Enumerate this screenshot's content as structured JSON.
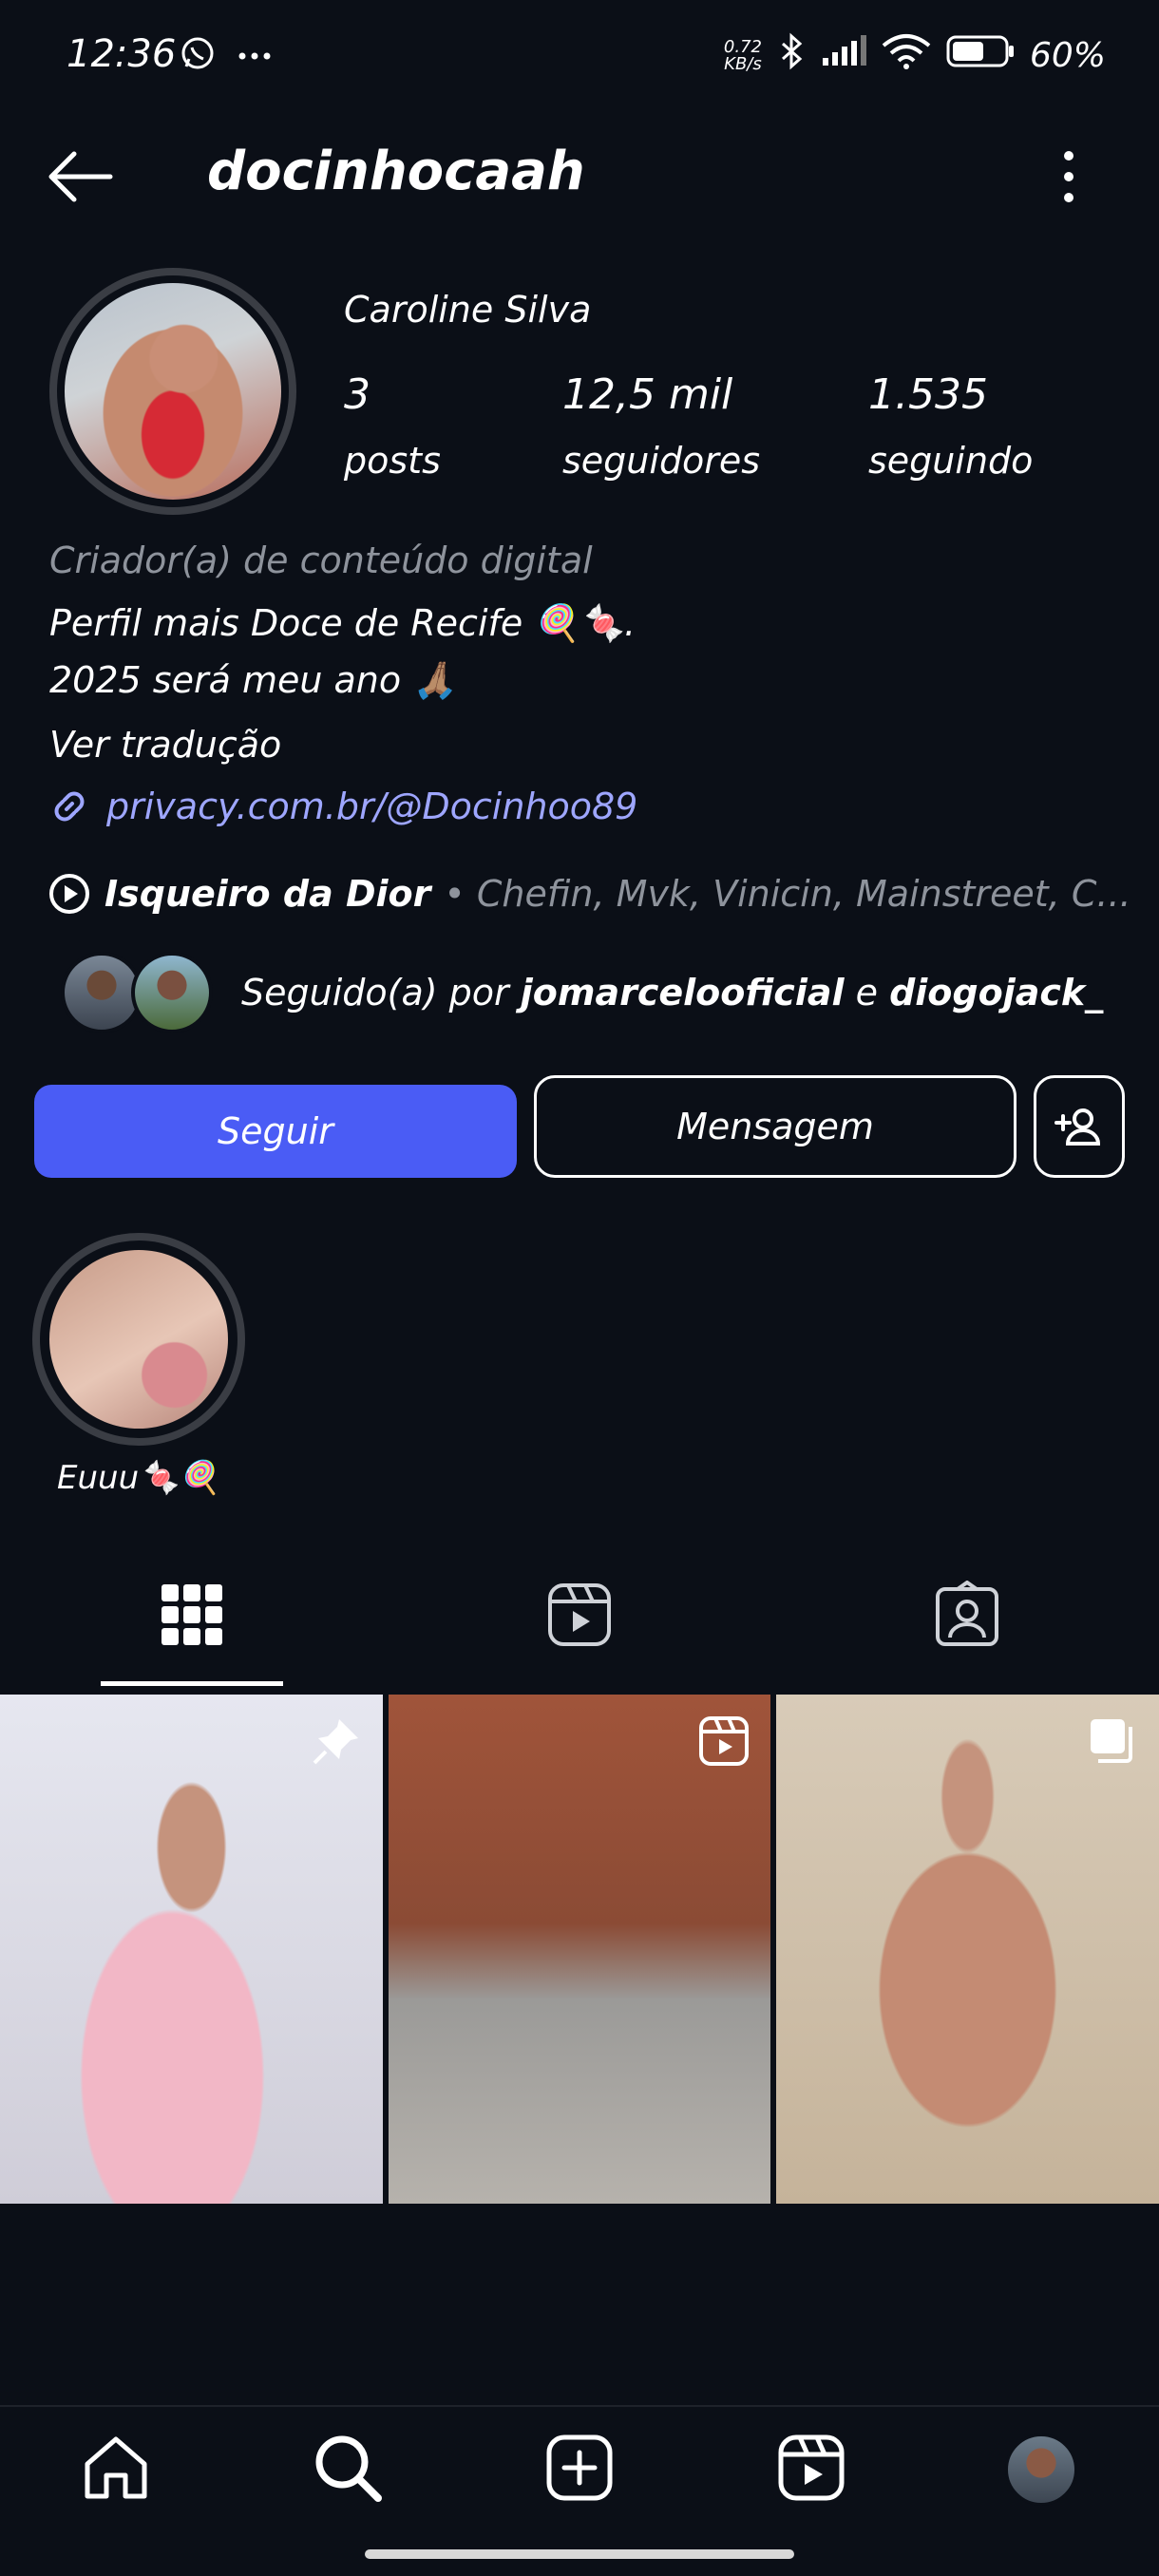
{
  "status_bar": {
    "time": "12:36",
    "net_speed_value": "0.72",
    "net_speed_unit": "KB/s",
    "battery": "60%",
    "icons": [
      "whatsapp-icon",
      "more-dots-icon",
      "bluetooth-icon",
      "signal-icon",
      "wifi-icon",
      "battery-icon"
    ]
  },
  "header": {
    "username": "docinhocaah"
  },
  "profile": {
    "full_name": "Caroline Silva",
    "posts_count": "3",
    "posts_label": "posts",
    "followers_count": "12,5 mil",
    "followers_label": "seguidores",
    "following_count": "1.535",
    "following_label": "seguindo",
    "category": "Criador(a) de conteúdo digital",
    "bio_line1": "Perfil mais Doce de Recife 🍭🍬.",
    "bio_line2": "2025 será meu ano 🙏🏽",
    "translate": "Ver tradução",
    "link": "privacy.com.br/@Docinhoo89",
    "music_title": "Isqueiro da Dior",
    "music_artists": "• Chefin, Mvk, Vinicin, Mainstreet, C...",
    "followed_prefix": "Seguido(a) por ",
    "followed_user1": "jomarcelooficial",
    "followed_conj": " e ",
    "followed_user2": "diogojack_"
  },
  "actions": {
    "follow_label": "Seguir",
    "message_label": "Mensagem"
  },
  "highlights": [
    {
      "label": "Euuu🍬🍭"
    }
  ],
  "tabs": [
    "posts-grid",
    "reels",
    "tagged"
  ],
  "grid": [
    {
      "type": "pinned-photo"
    },
    {
      "type": "reel"
    },
    {
      "type": "carousel"
    }
  ],
  "colors": {
    "background": "#0b0f17",
    "follow_button": "#4a5cf5",
    "link": "#9ea6ff",
    "muted_text": "#8e939c"
  },
  "bottom_nav": [
    "home-icon",
    "search-icon",
    "create-icon",
    "reels-icon",
    "profile-avatar"
  ]
}
